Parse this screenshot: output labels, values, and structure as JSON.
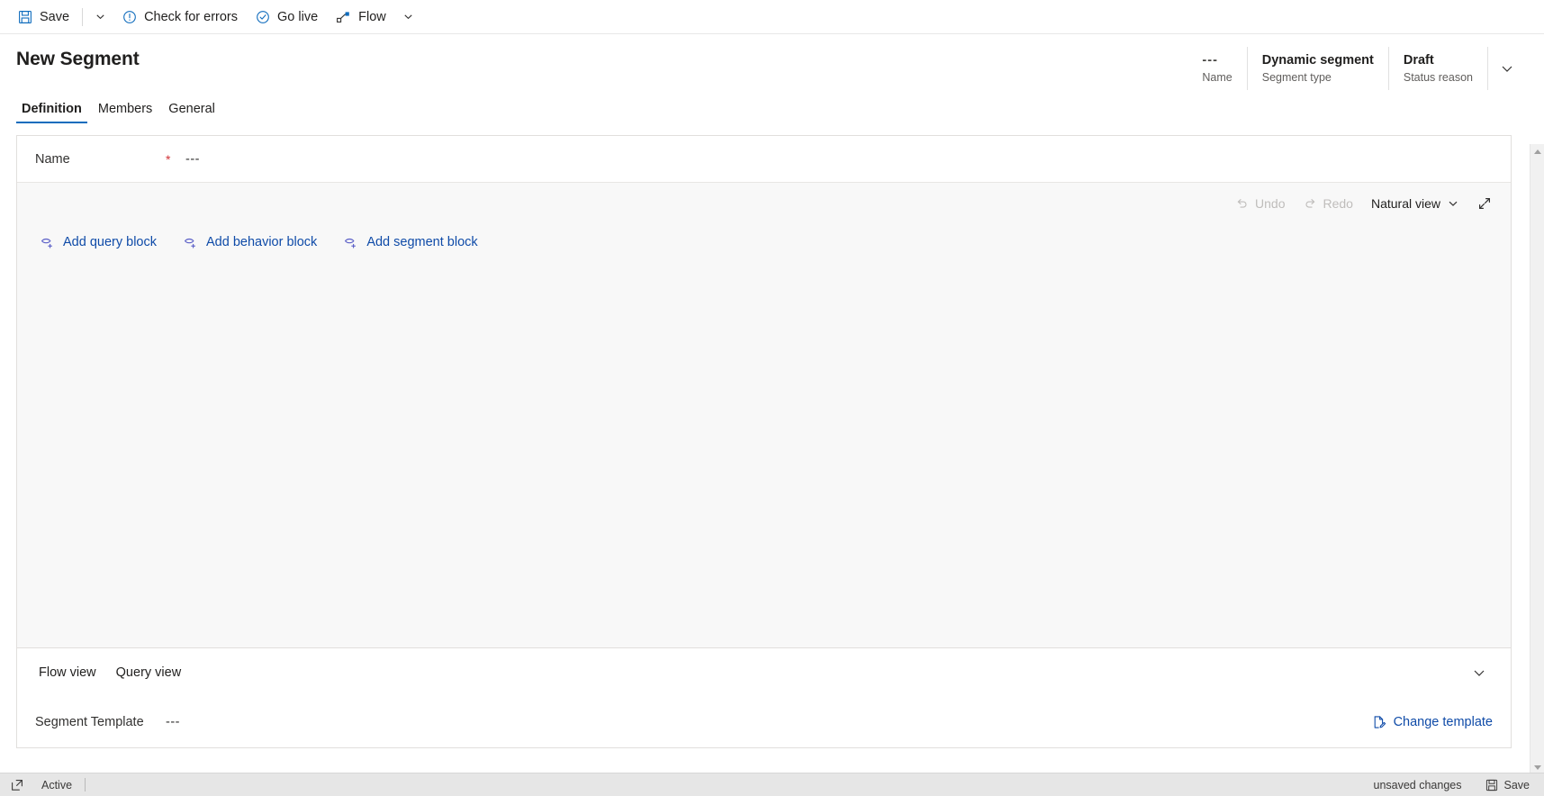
{
  "commandbar": {
    "items": [
      {
        "label": "Save",
        "icon": "save-icon"
      },
      {
        "label": "Check for errors",
        "icon": "error-circle-icon"
      },
      {
        "label": "Go live",
        "icon": "check-circle-icon"
      },
      {
        "label": "Flow",
        "icon": "flow-icon"
      }
    ],
    "caret_icon": "chevron-down-icon"
  },
  "header": {
    "title": "New Segment",
    "meta": [
      {
        "value": "---",
        "label": "Name"
      },
      {
        "value": "Dynamic segment",
        "label": "Segment type"
      },
      {
        "value": "Draft",
        "label": "Status reason"
      }
    ],
    "chevron_icon": "chevron-down-icon"
  },
  "tabs": [
    {
      "label": "Definition",
      "active": true
    },
    {
      "label": "Members",
      "active": false
    },
    {
      "label": "General",
      "active": false
    }
  ],
  "form": {
    "name_label": "Name",
    "required_marker": "*",
    "name_value": "---"
  },
  "canvas": {
    "toolbar": [
      {
        "label": "Undo",
        "icon": "undo-icon",
        "disabled": true
      },
      {
        "label": "Redo",
        "icon": "redo-icon",
        "disabled": false
      },
      {
        "label": "Natural view",
        "icon": "chevron-down-icon",
        "disabled": false
      },
      {
        "label": "",
        "icon": "expand-icon",
        "disabled": false
      }
    ],
    "view_mode": "Natural view",
    "add_blocks": [
      {
        "label": "Add query block",
        "icon": "add-block-icon"
      },
      {
        "label": "Add behavior block",
        "icon": "add-block-icon"
      },
      {
        "label": "Add segment block",
        "icon": "add-block-icon"
      }
    ]
  },
  "bottom_panel": {
    "views": [
      {
        "label": "Flow view"
      },
      {
        "label": "Query view"
      }
    ],
    "collapse_icon": "chevron-down-icon",
    "template_label": "Segment Template",
    "template_value": "---",
    "change_template_label": "Change template",
    "change_template_icon": "page-edit-icon"
  },
  "statusbar": {
    "popout_icon": "popout-icon",
    "status_text": "Active",
    "unsaved_text": "unsaved changes",
    "save_label": "Save",
    "save_icon": "save-icon"
  },
  "colors": {
    "accent": "#0f6cbd",
    "link": "#0f4ba8",
    "required": "#d13438",
    "canvas_bg": "#f8f8f8",
    "statusbar_bg": "#e6e6e6"
  }
}
